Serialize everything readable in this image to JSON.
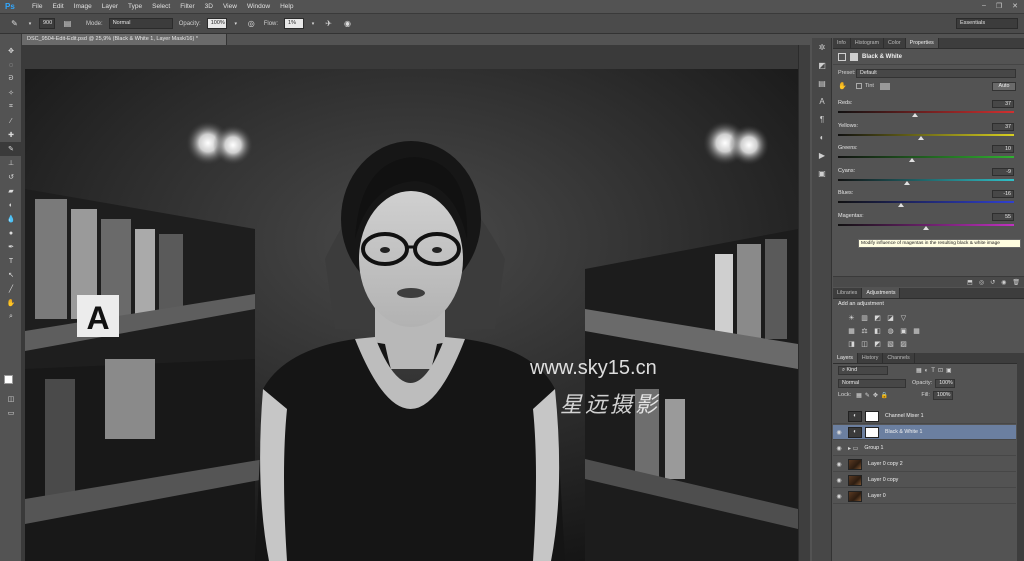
{
  "app": {
    "logo": "Ps"
  },
  "menu": [
    "File",
    "Edit",
    "Image",
    "Layer",
    "Type",
    "Select",
    "Filter",
    "3D",
    "View",
    "Window",
    "Help"
  ],
  "window_controls": [
    "–",
    "❐",
    "✕"
  ],
  "options": {
    "brush_size": "900",
    "mode_label": "Mode:",
    "mode_value": "Normal",
    "opacity_label": "Opacity:",
    "opacity_value": "100%",
    "flow_label": "Flow:",
    "flow_value": "1%",
    "workspace": "Essentials"
  },
  "document": {
    "tab": "DSC_9504-Edit-Edit.psd @ 25,9% (Black & White 1, Layer Mask/16) *",
    "watermark_url": "www.sky15.cn",
    "watermark_cn": "星远摄影",
    "sign_letter": "A"
  },
  "panel_tabs_top": [
    "Info",
    "Histogram",
    "Color",
    "Properties"
  ],
  "properties": {
    "title": "Black & White",
    "preset_label": "Preset:",
    "preset_value": "Default",
    "tint_label": "Tint",
    "auto_label": "Auto",
    "sliders": [
      {
        "label": "Reds:",
        "value": "37",
        "pos": 0.44,
        "color": "#d03030"
      },
      {
        "label": "Yellows:",
        "value": "37",
        "pos": 0.47,
        "color": "#d8d020"
      },
      {
        "label": "Greens:",
        "value": "10",
        "pos": 0.42,
        "color": "#30b030"
      },
      {
        "label": "Cyans:",
        "value": "-9",
        "pos": 0.39,
        "color": "#30c0c8"
      },
      {
        "label": "Blues:",
        "value": "-16",
        "pos": 0.36,
        "color": "#3040d0"
      },
      {
        "label": "Magentas:",
        "value": "55",
        "pos": 0.5,
        "color": "#c030c0"
      }
    ],
    "tooltip": "Modify influence of magentas in the resulting black & white image"
  },
  "adjustments": {
    "tabs": [
      "Libraries",
      "Adjustments"
    ],
    "heading": "Add an adjustment",
    "row1": [
      "☀",
      "▥",
      "◩",
      "◪",
      "▽"
    ],
    "row2": [
      "▦",
      "⚖",
      "◧",
      "◍",
      "▣",
      "▦"
    ],
    "row3": [
      "◨",
      "◫",
      "◩",
      "▧",
      "▨"
    ]
  },
  "layers": {
    "tabs": [
      "Layers",
      "History",
      "Channels"
    ],
    "kind_label": "Kind",
    "blend": "Normal",
    "opacity_label": "Opacity:",
    "opacity_value": "100%",
    "lock_label": "Lock:",
    "fill_label": "Fill:",
    "fill_value": "100%",
    "items": [
      {
        "name": "Channel Mixer 1",
        "thumb": "white",
        "visible": false,
        "selected": false
      },
      {
        "name": "Black & White 1",
        "thumb": "white",
        "visible": true,
        "selected": true
      },
      {
        "name": "Group 1",
        "thumb": "folder",
        "visible": true,
        "selected": false
      },
      {
        "name": "Layer 0 copy 2",
        "thumb": "photo",
        "visible": true,
        "selected": false
      },
      {
        "name": "Layer 0 copy",
        "thumb": "photo",
        "visible": true,
        "selected": false
      },
      {
        "name": "Layer 0",
        "thumb": "photo",
        "visible": true,
        "selected": false
      }
    ]
  }
}
